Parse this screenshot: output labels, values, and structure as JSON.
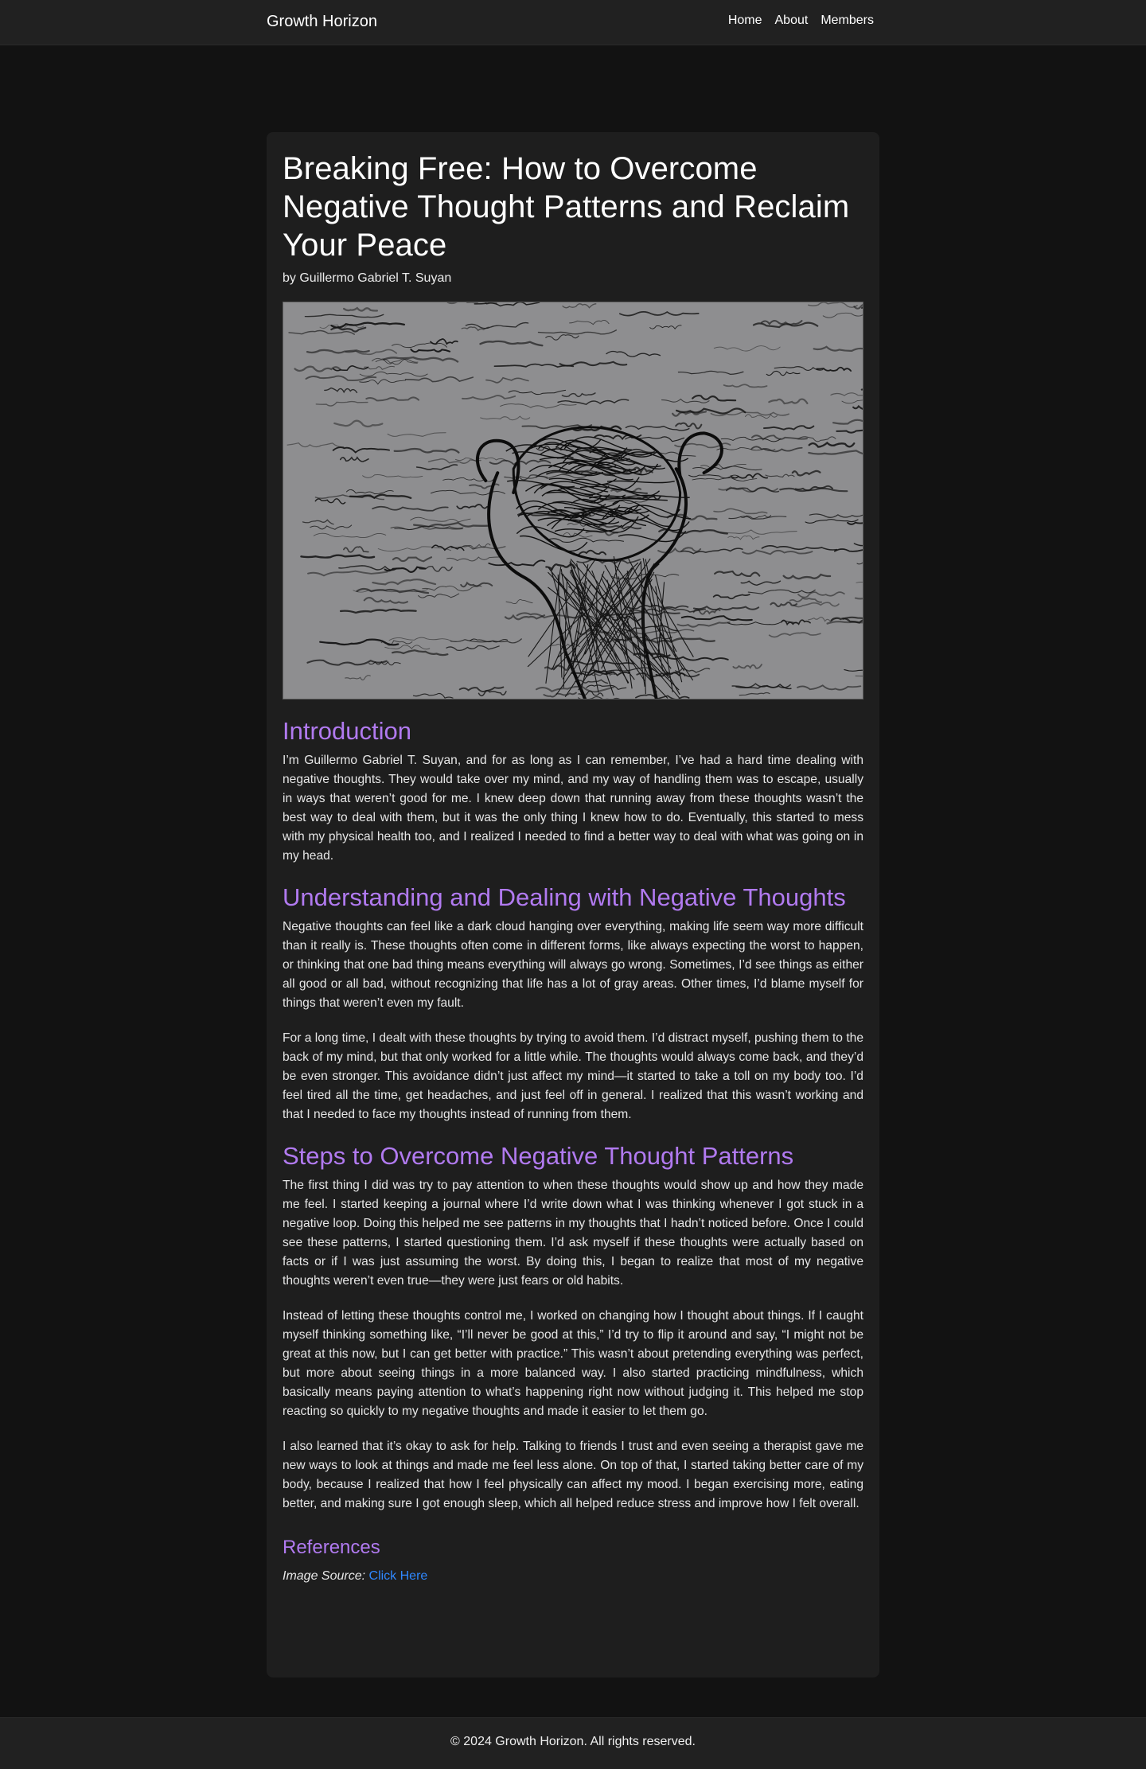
{
  "nav": {
    "brand": "Growth Horizon",
    "links": [
      "Home",
      "About",
      "Members"
    ]
  },
  "article": {
    "title": "Breaking Free: How to Overcome Negative Thought Patterns and Reclaim Your Peace",
    "byline": "by Guillermo Gabriel T. Suyan",
    "image_alt": "Sketch of a figure clutching its head surrounded by scribbled words",
    "sections": [
      {
        "heading": "Introduction",
        "paragraphs": [
          "I’m Guillermo Gabriel T. Suyan, and for as long as I can remember, I’ve had a hard time dealing with negative thoughts. They would take over my mind, and my way of handling them was to escape, usually in ways that weren’t good for me. I knew deep down that running away from these thoughts wasn’t the best way to deal with them, but it was the only thing I knew how to do. Eventually, this started to mess with my physical health too, and I realized I needed to find a better way to deal with what was going on in my head."
        ]
      },
      {
        "heading": "Understanding and Dealing with Negative Thoughts",
        "paragraphs": [
          "Negative thoughts can feel like a dark cloud hanging over everything, making life seem way more difficult than it really is. These thoughts often come in different forms, like always expecting the worst to happen, or thinking that one bad thing means everything will always go wrong. Sometimes, I’d see things as either all good or all bad, without recognizing that life has a lot of gray areas. Other times, I’d blame myself for things that weren’t even my fault.",
          "For a long time, I dealt with these thoughts by trying to avoid them. I’d distract myself, pushing them to the back of my mind, but that only worked for a little while. The thoughts would always come back, and they’d be even stronger. This avoidance didn’t just affect my mind—it started to take a toll on my body too. I’d feel tired all the time, get headaches, and just feel off in general. I realized that this wasn’t working and that I needed to face my thoughts instead of running from them."
        ]
      },
      {
        "heading": "Steps to Overcome Negative Thought Patterns",
        "paragraphs": [
          "The first thing I did was try to pay attention to when these thoughts would show up and how they made me feel. I started keeping a journal where I’d write down what I was thinking whenever I got stuck in a negative loop. Doing this helped me see patterns in my thoughts that I hadn’t noticed before. Once I could see these patterns, I started questioning them. I’d ask myself if these thoughts were actually based on facts or if I was just assuming the worst. By doing this, I began to realize that most of my negative thoughts weren’t even true—they were just fears or old habits.",
          "Instead of letting these thoughts control me, I worked on changing how I thought about things. If I caught myself thinking something like, “I’ll never be good at this,” I’d try to flip it around and say, “I might not be great at this now, but I can get better with practice.” This wasn’t about pretending everything was perfect, but more about seeing things in a more balanced way. I also started practicing mindfulness, which basically means paying attention to what’s happening right now without judging it. This helped me stop reacting so quickly to my negative thoughts and made it easier to let them go.",
          "I also learned that it’s okay to ask for help. Talking to friends I trust and even seeing a therapist gave me new ways to look at things and made me feel less alone. On top of that, I started taking better care of my body, because I realized that how I feel physically can affect my mood. I began exercising more, eating better, and making sure I got enough sleep, which all helped reduce stress and improve how I felt overall."
        ]
      }
    ],
    "references": {
      "heading": "References",
      "source_label": "Image Source:",
      "source_link": "Click Here"
    }
  },
  "footer": {
    "text": "© 2024 Growth Horizon. All rights reserved."
  },
  "colors": {
    "page_bg": "#121212",
    "card_bg": "#1e1e1e",
    "nav_bg": "#212121",
    "heading_accent": "#b17af0",
    "link": "#2f88ff"
  }
}
